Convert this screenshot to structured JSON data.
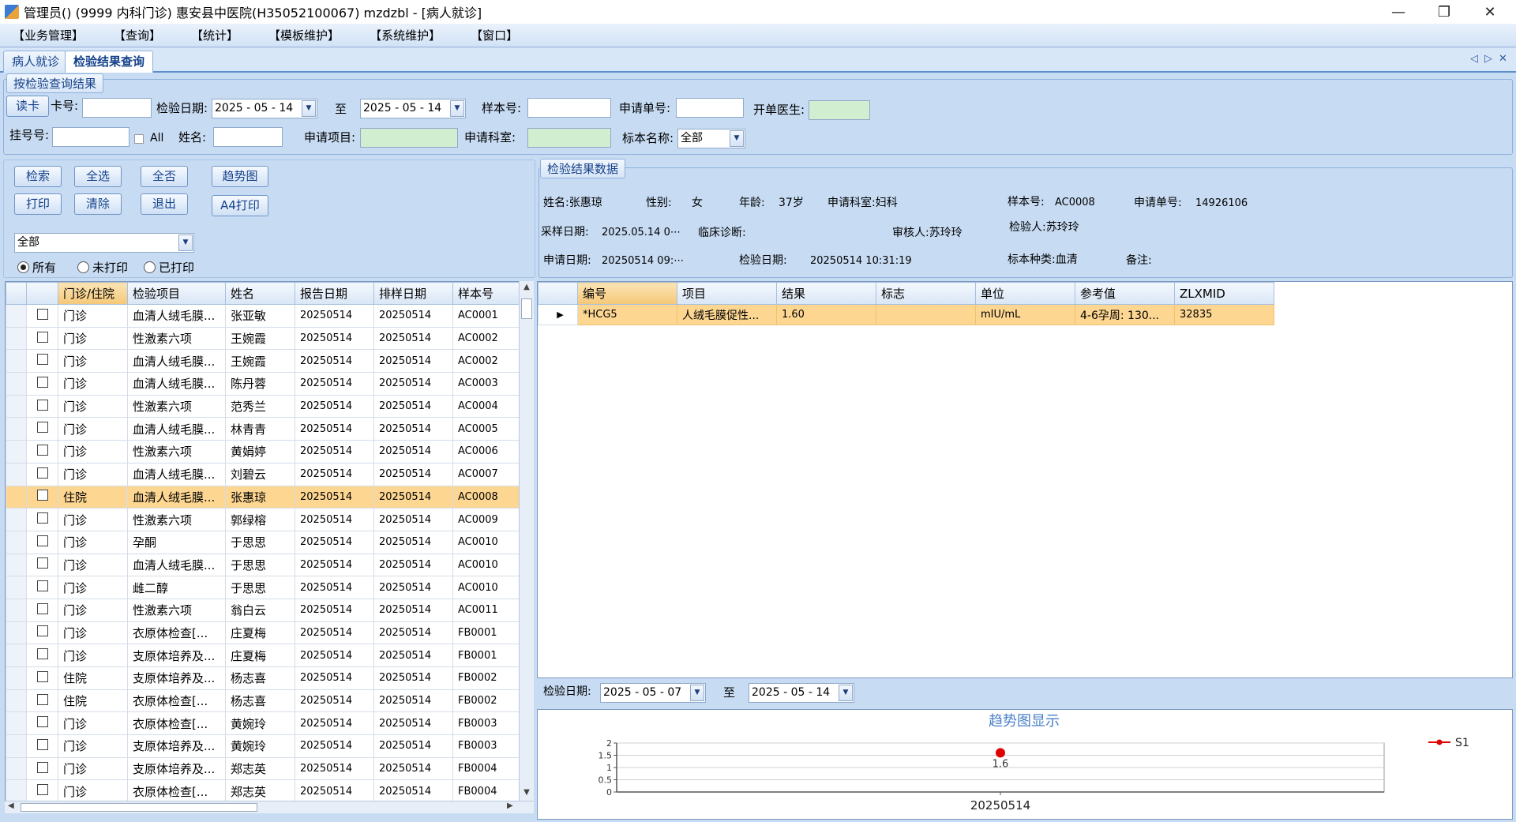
{
  "window": {
    "title": "管理员() (9999 内科门诊) 惠安县中医院(H35052100067) mzdzbl - [病人就诊]",
    "minimize": "—",
    "restore": "❐",
    "close": "✕"
  },
  "menu": [
    "【业务管理】",
    "【查询】",
    "【统计】",
    "【模板维护】",
    "【系统维护】",
    "【窗口】"
  ],
  "tabs": [
    "病人就诊",
    "检验结果查询"
  ],
  "tab_controls": {
    "left": "◁",
    "right": "▷",
    "close": "✕"
  },
  "query": {
    "group_label": "按检验查询结果",
    "read_card": "读卡",
    "card_no_label": "卡号:",
    "card_no": "",
    "date_label": "检验日期:",
    "date_from": "2025 - 05 - 14",
    "to_label": "至",
    "date_to": "2025 - 05 - 14",
    "sample_no_label": "样本号:",
    "sample_no": "",
    "apply_no_label": "申请单号:",
    "apply_no": "",
    "doctor_label": "开单医生:",
    "doctor": "",
    "reg_no_label": "挂号号:",
    "reg_no": "",
    "all_label": "All",
    "name_label": "姓名:",
    "name": "",
    "apply_item_label": "申请项目:",
    "apply_item": "",
    "apply_dept_label": "申请科室:",
    "apply_dept": "",
    "specimen_label": "标本名称:",
    "specimen": "全部"
  },
  "buttons": {
    "search": "检索",
    "select_all": "全选",
    "select_none": "全否",
    "trend": "趋势图",
    "print": "打印",
    "clear": "清除",
    "exit": "退出",
    "a4print": "A4打印"
  },
  "filter": {
    "value": "全部",
    "radios": [
      "所有",
      "未打印",
      "已打印"
    ],
    "selected": 0
  },
  "list": {
    "headers": [
      "门诊/住院",
      "检验项目",
      "姓名",
      "报告日期",
      "排样日期",
      "样本号"
    ],
    "rows": [
      [
        "门诊",
        "血清人绒毛膜...",
        "张亚敏",
        "20250514",
        "20250514",
        "AC0001"
      ],
      [
        "门诊",
        "性激素六项",
        "王婉霞",
        "20250514",
        "20250514",
        "AC0002"
      ],
      [
        "门诊",
        "血清人绒毛膜...",
        "王婉霞",
        "20250514",
        "20250514",
        "AC0002"
      ],
      [
        "门诊",
        "血清人绒毛膜...",
        "陈丹蓉",
        "20250514",
        "20250514",
        "AC0003"
      ],
      [
        "门诊",
        "性激素六项",
        "范秀兰",
        "20250514",
        "20250514",
        "AC0004"
      ],
      [
        "门诊",
        "血清人绒毛膜...",
        "林青青",
        "20250514",
        "20250514",
        "AC0005"
      ],
      [
        "门诊",
        "性激素六项",
        "黄娟婷",
        "20250514",
        "20250514",
        "AC0006"
      ],
      [
        "门诊",
        "血清人绒毛膜...",
        "刘碧云",
        "20250514",
        "20250514",
        "AC0007"
      ],
      [
        "住院",
        "血清人绒毛膜...",
        "张惠琼",
        "20250514",
        "20250514",
        "AC0008"
      ],
      [
        "门诊",
        "性激素六项",
        "郭绿榕",
        "20250514",
        "20250514",
        "AC0009"
      ],
      [
        "门诊",
        "孕酮",
        "于思思",
        "20250514",
        "20250514",
        "AC0010"
      ],
      [
        "门诊",
        "血清人绒毛膜...",
        "于思思",
        "20250514",
        "20250514",
        "AC0010"
      ],
      [
        "门诊",
        "雌二醇",
        "于思思",
        "20250514",
        "20250514",
        "AC0010"
      ],
      [
        "门诊",
        "性激素六项",
        "翁白云",
        "20250514",
        "20250514",
        "AC0011"
      ],
      [
        "门诊",
        "衣原体检查[...",
        "庄夏梅",
        "20250514",
        "20250514",
        "FB0001"
      ],
      [
        "门诊",
        "支原体培养及...",
        "庄夏梅",
        "20250514",
        "20250514",
        "FB0001"
      ],
      [
        "住院",
        "支原体培养及...",
        "杨志喜",
        "20250514",
        "20250514",
        "FB0002"
      ],
      [
        "住院",
        "衣原体检查[...",
        "杨志喜",
        "20250514",
        "20250514",
        "FB0002"
      ],
      [
        "门诊",
        "衣原体检查[...",
        "黄婉玲",
        "20250514",
        "20250514",
        "FB0003"
      ],
      [
        "门诊",
        "支原体培养及...",
        "黄婉玲",
        "20250514",
        "20250514",
        "FB0003"
      ],
      [
        "门诊",
        "支原体培养及...",
        "郑志英",
        "20250514",
        "20250514",
        "FB0004"
      ],
      [
        "门诊",
        "衣原体检查[...",
        "郑志英",
        "20250514",
        "20250514",
        "FB0004"
      ]
    ],
    "selected_index": 8
  },
  "result": {
    "group_label": "检验结果数据",
    "name": "姓名:张惠琼",
    "sex_label": "性别:",
    "sex": "女",
    "age_label": "年龄:",
    "age": "37岁",
    "dept": "申请科室:妇科",
    "sample_no_label": "样本号:",
    "sample_no": "AC0008",
    "apply_no_label": "申请单号:",
    "apply_no": "14926106",
    "collect_label": "采样日期:",
    "collect_date": "2025.05.14 0⋯",
    "diag_label": "临床诊断:",
    "reviewer": "审核人:苏玲玲",
    "tester": "检验人:苏玲玲",
    "apply_date_label": "申请日期:",
    "apply_date": "20250514 09:⋯",
    "test_date_label": "检验日期:",
    "test_date": "20250514 10:31:19",
    "specimen": "标本种类:血清",
    "remark_label": "备注:"
  },
  "result_grid": {
    "headers": [
      "编号",
      "项目",
      "结果",
      "标志",
      "单位",
      "参考值",
      "ZLXMID"
    ],
    "rows": [
      [
        "*HCG5",
        "人绒毛膜促性...",
        "1.60",
        "",
        "mIU/mL",
        "4-6孕周: 130...",
        "32835"
      ]
    ]
  },
  "trend_filter": {
    "label": "检验日期:",
    "from": "2025 - 05 - 07",
    "to_label": "至",
    "to": "2025 - 05 - 14"
  },
  "chart_data": {
    "type": "line",
    "title": "趋势图显示",
    "categories": [
      "20250514"
    ],
    "series": [
      {
        "name": "S1",
        "values": [
          1.6
        ]
      }
    ],
    "data_labels": [
      "1.6"
    ],
    "y_ticks": [
      "2",
      "1.5",
      "1",
      "0.5",
      "0"
    ],
    "ylim": [
      0,
      2
    ],
    "legend": "right",
    "color": "#e00000"
  }
}
